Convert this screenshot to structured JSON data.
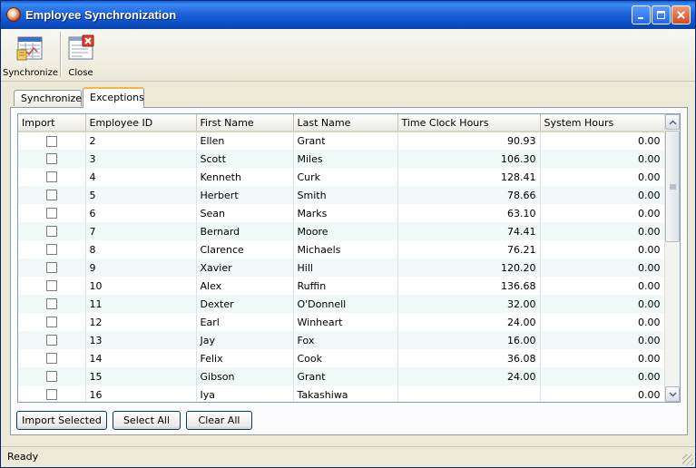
{
  "window": {
    "title": "Employee Synchronization"
  },
  "toolbar": {
    "synchronize_label": "Synchronize",
    "close_label": "Close"
  },
  "tabs": [
    {
      "label": "Synchronize"
    },
    {
      "label": "Exceptions"
    }
  ],
  "grid": {
    "columns": [
      "Import",
      "Employee ID",
      "First Name",
      "Last Name",
      "Time Clock Hours",
      "System Hours"
    ],
    "rows": [
      {
        "id": "2",
        "first": "Ellen",
        "last": "Grant",
        "tc": "90.93",
        "sys": "0.00"
      },
      {
        "id": "3",
        "first": "Scott",
        "last": "Miles",
        "tc": "106.30",
        "sys": "0.00"
      },
      {
        "id": "4",
        "first": "Kenneth",
        "last": "Curk",
        "tc": "128.41",
        "sys": "0.00"
      },
      {
        "id": "5",
        "first": "Herbert",
        "last": "Smith",
        "tc": "78.66",
        "sys": "0.00"
      },
      {
        "id": "6",
        "first": "Sean",
        "last": "Marks",
        "tc": "63.10",
        "sys": "0.00"
      },
      {
        "id": "7",
        "first": "Bernard",
        "last": "Moore",
        "tc": "74.41",
        "sys": "0.00"
      },
      {
        "id": "8",
        "first": "Clarence",
        "last": "Michaels",
        "tc": "76.21",
        "sys": "0.00"
      },
      {
        "id": "9",
        "first": "Xavier",
        "last": "Hill",
        "tc": "120.20",
        "sys": "0.00"
      },
      {
        "id": "10",
        "first": "Alex",
        "last": "Ruffin",
        "tc": "136.68",
        "sys": "0.00"
      },
      {
        "id": "11",
        "first": "Dexter",
        "last": "O'Donnell",
        "tc": "32.00",
        "sys": "0.00"
      },
      {
        "id": "12",
        "first": "Earl",
        "last": "Winheart",
        "tc": "24.00",
        "sys": "0.00"
      },
      {
        "id": "13",
        "first": "Jay",
        "last": "Fox",
        "tc": "16.00",
        "sys": "0.00"
      },
      {
        "id": "14",
        "first": "Felix",
        "last": "Cook",
        "tc": "36.08",
        "sys": "0.00"
      },
      {
        "id": "15",
        "first": "Gibson",
        "last": "Grant",
        "tc": "24.00",
        "sys": "0.00"
      },
      {
        "id": "16",
        "first": "Iya",
        "last": "Takashiwa",
        "tc": "",
        "sys": "0.00"
      }
    ]
  },
  "buttons": {
    "import_selected": "Import Selected",
    "select_all": "Select All",
    "clear_all": "Clear All"
  },
  "status": {
    "text": "Ready"
  }
}
